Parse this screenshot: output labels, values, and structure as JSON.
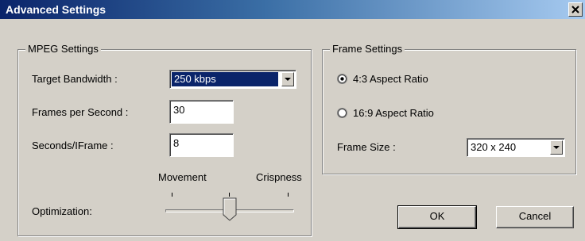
{
  "window": {
    "title": "Advanced Settings",
    "close_label": "×"
  },
  "mpeg": {
    "legend": "MPEG Settings",
    "target_bandwidth_label": "Target Bandwidth :",
    "target_bandwidth_value": "250 kbps",
    "fps_label": "Frames per Second :",
    "fps_value": "30",
    "seconds_iframe_label": "Seconds/IFrame :",
    "seconds_iframe_value": "8",
    "optimization_label": "Optimization:",
    "movement_label": "Movement",
    "crispness_label": "Crispness",
    "optimization_level": 0.5
  },
  "frame": {
    "legend": "Frame Settings",
    "aspect_4_3_label": "4:3 Aspect Ratio",
    "aspect_16_9_label": "16:9 Aspect Ratio",
    "aspect_selected": "4:3",
    "frame_size_label": "Frame Size :",
    "frame_size_value": "320 x 240"
  },
  "buttons": {
    "ok": "OK",
    "cancel": "Cancel"
  }
}
